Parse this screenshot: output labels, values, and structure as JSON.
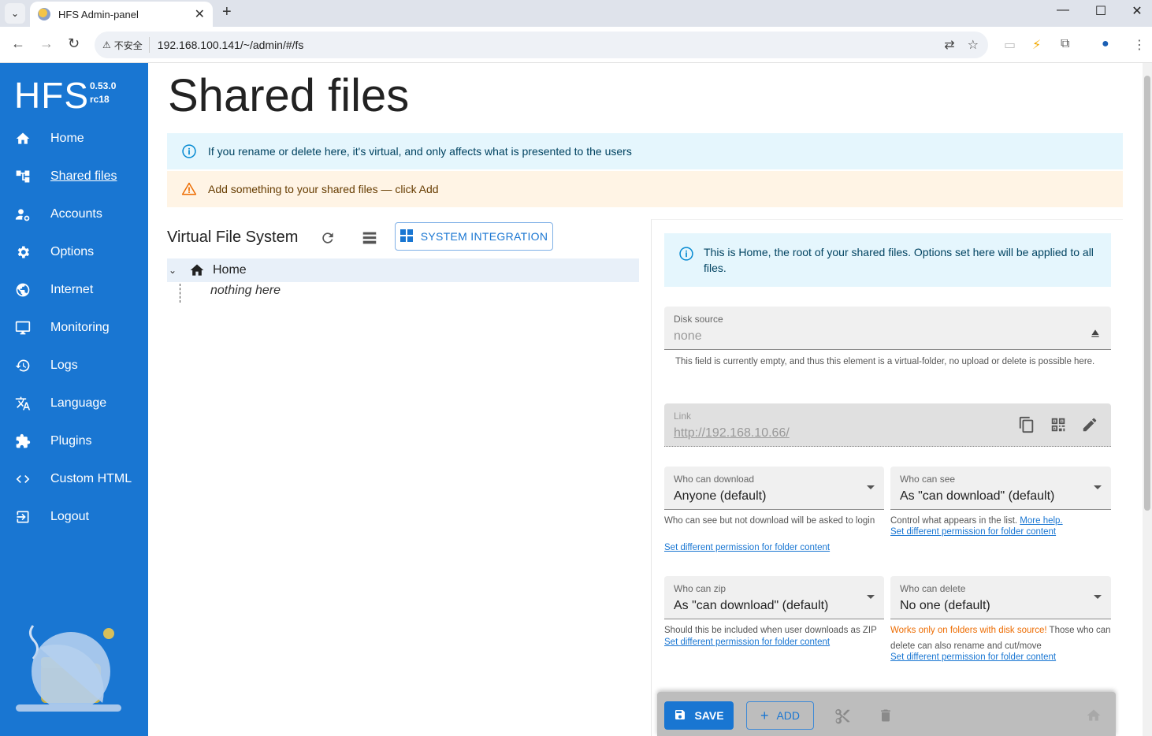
{
  "browser": {
    "tab_title": "HFS Admin-panel",
    "security_label": "不安全",
    "url": "192.168.100.141/~/admin/#/fs"
  },
  "sidebar": {
    "logo": "HFS",
    "version": "0.53.0",
    "version_tag": "rc18",
    "items": [
      {
        "label": "Home",
        "icon": "home-icon"
      },
      {
        "label": "Shared files",
        "icon": "tree-icon",
        "active": true
      },
      {
        "label": "Accounts",
        "icon": "accounts-icon"
      },
      {
        "label": "Options",
        "icon": "gear-icon"
      },
      {
        "label": "Internet",
        "icon": "globe-icon"
      },
      {
        "label": "Monitoring",
        "icon": "monitor-icon"
      },
      {
        "label": "Logs",
        "icon": "history-icon"
      },
      {
        "label": "Language",
        "icon": "translate-icon"
      },
      {
        "label": "Plugins",
        "icon": "puzzle-icon"
      },
      {
        "label": "Custom HTML",
        "icon": "code-icon"
      },
      {
        "label": "Logout",
        "icon": "logout-icon"
      }
    ]
  },
  "main": {
    "title": "Shared files",
    "info_alert": "If you rename or delete here, it's virtual, and only affects what is presented to the users",
    "warn_alert": "Add something to your shared files — click Add",
    "vfs_title": "Virtual File System",
    "system_integration": "SYSTEM INTEGRATION",
    "tree_root": "Home",
    "tree_empty": "nothing here"
  },
  "panel": {
    "info": "This is Home, the root of your shared files. Options set here will be applied to all files.",
    "disk_source_label": "Disk source",
    "disk_source_value": "none",
    "disk_source_help": "This field is currently empty, and thus this element is a virtual-folder, no upload or delete is possible here.",
    "link_label": "Link",
    "link_value": "http://192.168.10.66/",
    "who_download_label": "Who can download",
    "who_download_value": "Anyone (default)",
    "who_download_help": "Who can see but not download will be asked to login",
    "who_see_label": "Who can see",
    "who_see_value": "As \"can download\" (default)",
    "who_see_help": "Control what appears in the list.",
    "more_help": "More help.",
    "who_zip_label": "Who can zip",
    "who_zip_value": "As \"can download\" (default)",
    "who_zip_help": "Should this be included when user downloads as ZIP",
    "who_delete_label": "Who can delete",
    "who_delete_value": "No one (default)",
    "who_delete_warn": "Works only on folders with disk source!",
    "who_delete_help": " Those who can delete can also rename and cut/move",
    "set_permission": "Set different permission for folder content"
  },
  "actions": {
    "save": "SAVE",
    "add": "ADD"
  },
  "colors": {
    "brand": "#1976d2",
    "info_bg": "#e5f6fd",
    "warn_bg": "#fff4e5",
    "warning": "#ed6c02"
  }
}
